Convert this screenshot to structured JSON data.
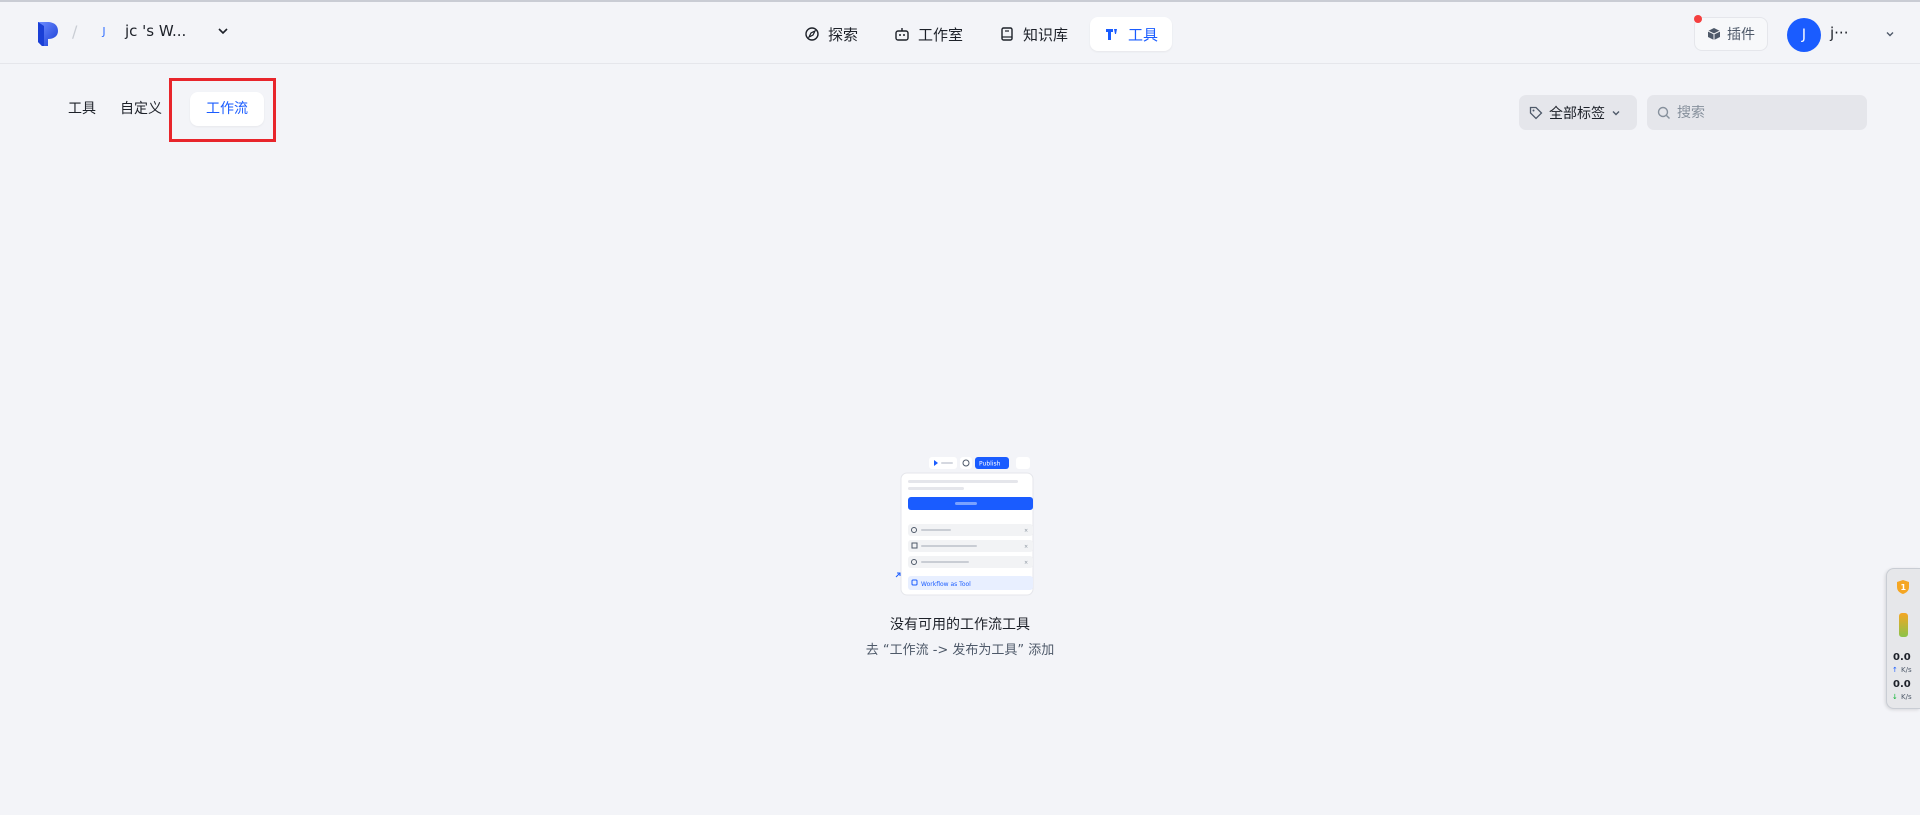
{
  "header": {
    "separator": "/",
    "workspace_avatar": "J",
    "workspace_name": "jc    's W...",
    "nav": [
      {
        "label": "探索",
        "icon": "explore-icon",
        "active": false
      },
      {
        "label": "工作室",
        "icon": "robot-icon",
        "active": false
      },
      {
        "label": "知识库",
        "icon": "book-icon",
        "active": false
      },
      {
        "label": "工具",
        "icon": "tool-icon",
        "active": true
      }
    ],
    "plugin_label": "插件",
    "user_avatar": "J",
    "user_name": "j···"
  },
  "subtabs": [
    {
      "label": "工具",
      "active": false
    },
    {
      "label": "自定义",
      "active": false
    },
    {
      "label": "工作流",
      "active": true
    }
  ],
  "filters": {
    "tag_label": "全部标签",
    "search_placeholder": "搜索"
  },
  "empty_state": {
    "title": "没有可用的工作流工具",
    "subtitle": "去 “工作流 -> 发布为工具” 添加",
    "illustration": {
      "publish_label": "Publish",
      "card_label": "Workflow as Tool"
    }
  },
  "net_widget": {
    "upload_value": "0.0",
    "upload_unit": "K/s",
    "download_value": "0.0",
    "download_unit": "K/s"
  },
  "colors": {
    "accent": "#1a5cff",
    "background": "#f3f4f8",
    "highlight": "#e8252b"
  }
}
